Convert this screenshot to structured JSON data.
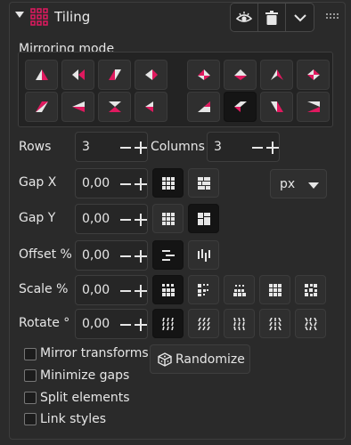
{
  "header": {
    "title": "Tiling"
  },
  "mirroring": {
    "label": "Mirroring mode",
    "selected_index": 13
  },
  "rows": {
    "label": "Rows",
    "value": "3"
  },
  "columns": {
    "label": "Columns",
    "value": "3"
  },
  "gap_x": {
    "label": "Gap X",
    "value": "0,00"
  },
  "gap_y": {
    "label": "Gap Y",
    "value": "0,00"
  },
  "offset": {
    "label": "Offset %",
    "value": "0,00"
  },
  "scale": {
    "label": "Scale %",
    "value": "0,00"
  },
  "rotate": {
    "label": "Rotate °",
    "value": "0,00"
  },
  "unit": {
    "value": "px"
  },
  "checkboxes": {
    "mirror_transforms": "Mirror transforms",
    "minimize_gaps": "Minimize gaps",
    "split_elements": "Split elements",
    "link_styles": "Link styles"
  },
  "randomize_label": "Randomize",
  "colors": {
    "accent": "#e0195f",
    "panel": "#2a2a2a",
    "text": "#e6e6e6"
  }
}
